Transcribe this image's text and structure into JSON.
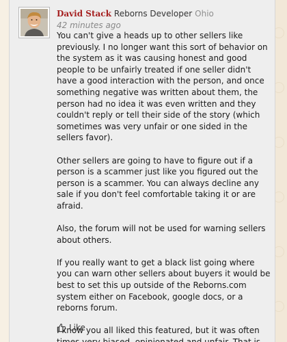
{
  "post": {
    "author": {
      "name": "David Stack",
      "title": "Reborns Developer",
      "location": "Ohio",
      "avatar_icon": "user-avatar"
    },
    "timestamp": "42 minutes ago",
    "paragraphs": [
      "You can't give a heads up to other sellers like previously. I no longer want this sort of behavior on the system as it was causing honest and good people to be unfairly treated if one seller didn't have a good interaction with the person, and once something negative was written about them, the person had no idea it was even written and they couldn't reply or tell their side of the story (which sometimes was very unfair or one sided in the sellers favor).",
      "Other sellers are going to have to figure out if a person is a scammer just like you figured out the person is a scammer. You can always decline any sale if you don't feel comfortable taking it or are afraid.",
      "Also, the forum will not be used for warning sellers about others.",
      "If you really want to get a black list going where you can warn other sellers about buyers it would be best to set this up outside of the Reborns.com system either on Facebook, google docs, or a reborns forum.",
      "I know you all liked this featured, but it was often times very biased, opinionated and unfair. That is why it has been removed."
    ],
    "like_label": "Like",
    "like_icon": "thumbs-up-icon"
  },
  "colors": {
    "author_name": "#a52020",
    "post_background": "#eeeeee",
    "page_background": "#f7f0e4",
    "location": "#8f8f8f"
  }
}
